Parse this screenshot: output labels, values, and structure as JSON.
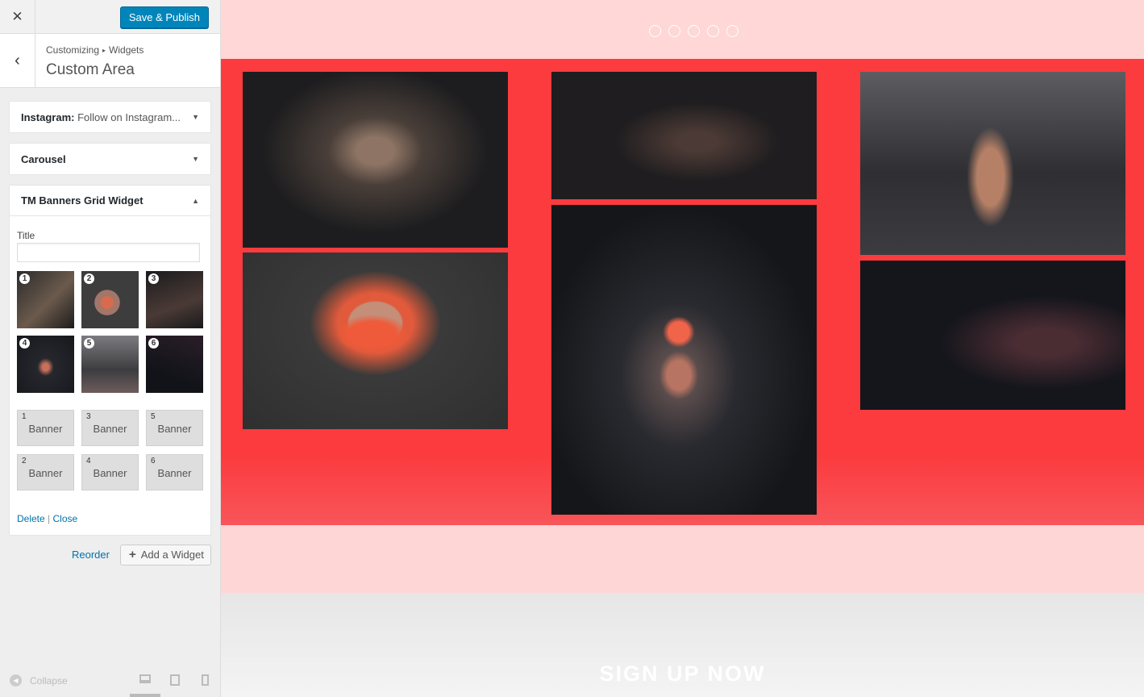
{
  "topbar": {
    "close_icon": "close-icon",
    "publish_label": "Save & Publish"
  },
  "section": {
    "breadcrumb": [
      "Customizing",
      "Widgets"
    ],
    "title": "Custom Area"
  },
  "widgets": [
    {
      "name": "Instagram:",
      "subtitle": "Follow on Instagram...",
      "expanded": false
    },
    {
      "name": "Carousel",
      "subtitle": "",
      "expanded": false
    },
    {
      "name": "TM Banners Grid Widget",
      "subtitle": "",
      "expanded": true
    }
  ],
  "banners_widget": {
    "title_label": "Title",
    "title_value": "",
    "thumbnails": [
      "1",
      "2",
      "3",
      "4",
      "5",
      "6"
    ],
    "banner_buttons": [
      {
        "num": "1",
        "label": "Banner"
      },
      {
        "num": "3",
        "label": "Banner"
      },
      {
        "num": "5",
        "label": "Banner"
      },
      {
        "num": "2",
        "label": "Banner"
      },
      {
        "num": "4",
        "label": "Banner"
      },
      {
        "num": "6",
        "label": "Banner"
      }
    ],
    "delete_label": "Delete",
    "separator": "|",
    "close_label": "Close"
  },
  "area_actions": {
    "reorder_label": "Reorder",
    "add_label": "Add a Widget"
  },
  "footer": {
    "collapse_label": "Collapse",
    "active_device": "desktop"
  },
  "preview": {
    "carousel_dot_count": 5,
    "signup_label": "SIGN UP NOW",
    "colors": {
      "accent_red": "#fc3b3e",
      "pink_bg": "#ffd7d7",
      "button_blue": "#0085ba",
      "link_blue": "#0073aa"
    }
  }
}
